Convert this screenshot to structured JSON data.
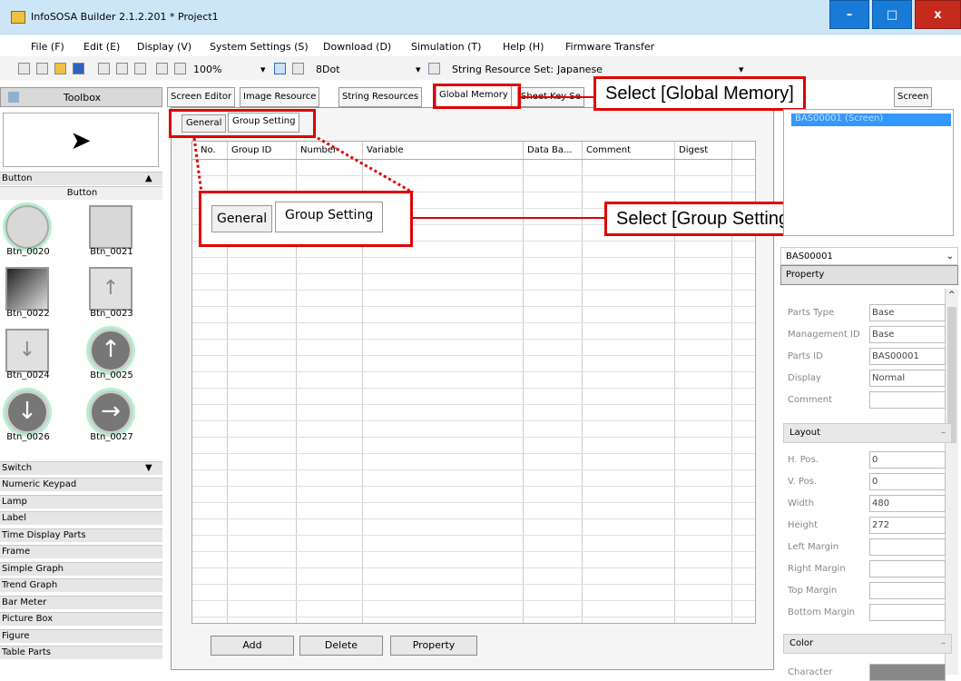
{
  "app": {
    "title": "InfoSOSA Builder 2.1.2.201 * Project1",
    "window_controls": {
      "minimize": "–",
      "maximize": "□",
      "close": "x"
    }
  },
  "menu": [
    "File (F)",
    "Edit (E)",
    "Display (V)",
    "System Settings (S)",
    "Download (D)",
    "Simulation (T)",
    "Help (H)",
    "Firmware Transfer"
  ],
  "toolbar": {
    "zoom": "100%",
    "dot": "8Dot",
    "string_resource_label": "String Resource Set:",
    "string_resource_value": "Japanese"
  },
  "toolbox": {
    "title": "Toolbox",
    "category_button": "Button",
    "subcategory": "Button",
    "items": [
      "Btn_0020",
      "Btn_0021",
      "Btn_0022",
      "Btn_0023",
      "Btn_0024",
      "Btn_0025",
      "Btn_0026",
      "Btn_0027"
    ],
    "categories": [
      "Switch",
      "Numeric Keypad",
      "Lamp",
      "Label",
      "Time Display Parts",
      "Frame",
      "Simple Graph",
      "Trend Graph",
      "Bar Meter",
      "Picture Box",
      "Figure",
      "Table Parts"
    ]
  },
  "tabs": [
    "Screen Editor",
    "Image Resource",
    "String Resources",
    "Global Memory",
    "Sheet Key Se"
  ],
  "right_tab": "Screen",
  "subtabs": [
    "General",
    "Group Setting"
  ],
  "columns": [
    "No.",
    "Group ID",
    "Number",
    "Variable",
    "Data Ba...",
    "Comment",
    "Digest"
  ],
  "bottom_buttons": [
    "Add",
    "Delete",
    "Property"
  ],
  "callouts": {
    "global_memory": "Select [Global Memory]",
    "group_setting": "Select [Group Setting]"
  },
  "right_panel": {
    "screen_item": "BAS00001 (Screen)",
    "selector": "BAS00001",
    "property_header": "Property",
    "properties": [
      {
        "label": "Parts Type",
        "value": "Base"
      },
      {
        "label": "Management ID",
        "value": "Base"
      },
      {
        "label": "Parts ID",
        "value": "BAS00001"
      },
      {
        "label": "Display",
        "value": "Normal"
      },
      {
        "label": "Comment",
        "value": ""
      }
    ],
    "layout_header": "Layout",
    "layout": [
      {
        "label": "H. Pos.",
        "value": "0"
      },
      {
        "label": "V. Pos.",
        "value": "0"
      },
      {
        "label": "Width",
        "value": "480"
      },
      {
        "label": "Height",
        "value": "272"
      },
      {
        "label": "Left Margin",
        "value": ""
      },
      {
        "label": "Right Margin",
        "value": ""
      },
      {
        "label": "Top Margin",
        "value": ""
      },
      {
        "label": "Bottom Margin",
        "value": ""
      }
    ],
    "color_header": "Color",
    "color_row": "Character"
  }
}
